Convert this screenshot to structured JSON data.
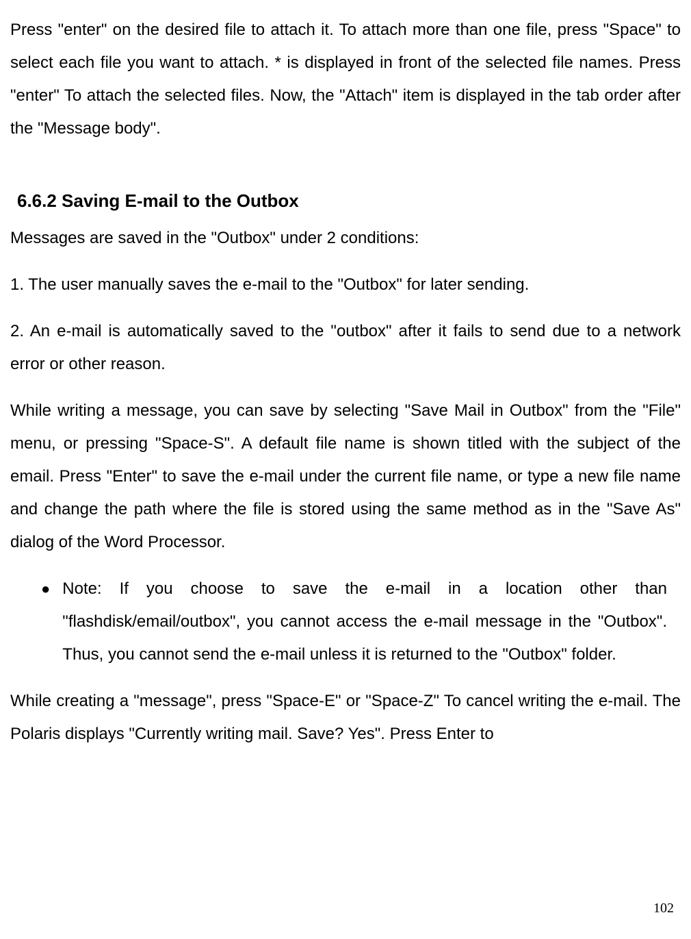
{
  "intro_paragraph": "Press \"enter\" on the desired file to attach it. To attach more than one file, press \"Space\" to select each file you want to attach. * is displayed in front of the selected file names. Press \"enter\" To attach the selected files. Now, the \"Attach\" item is displayed in the tab order after the \"Message body\".",
  "section": {
    "heading": "6.6.2 Saving E-mail to the Outbox",
    "lead": "Messages are saved in the \"Outbox\" under 2 conditions:",
    "item1": "1. The user manually saves the e-mail to the \"Outbox\" for later sending.",
    "item2": "2. An e-mail is automatically saved to the \"outbox\" after it fails to send due to a network error or other reason.",
    "body1": "While writing a message, you can save by selecting \"Save Mail in Outbox\" from the \"File\" menu, or pressing \"Space-S\". A default file name is shown titled with the subject of the email. Press \"Enter\" to save the e-mail under the current file name, or type a new file name and change the path where the file is stored using the same method as in the \"Save As\" dialog of the Word Processor.",
    "note": "Note: If you choose to save the e-mail in a location other than \"flashdisk/email/outbox\", you cannot access the e-mail message in the \"Outbox\". Thus, you cannot send the e-mail unless it is returned to the \"Outbox\" folder.",
    "body2": "While creating a \"message\", press \"Space-E\" or \"Space-Z\" To cancel writing the e-mail. The Polaris displays \"Currently writing mail. Save? Yes\". Press Enter to"
  },
  "page_number": "102"
}
